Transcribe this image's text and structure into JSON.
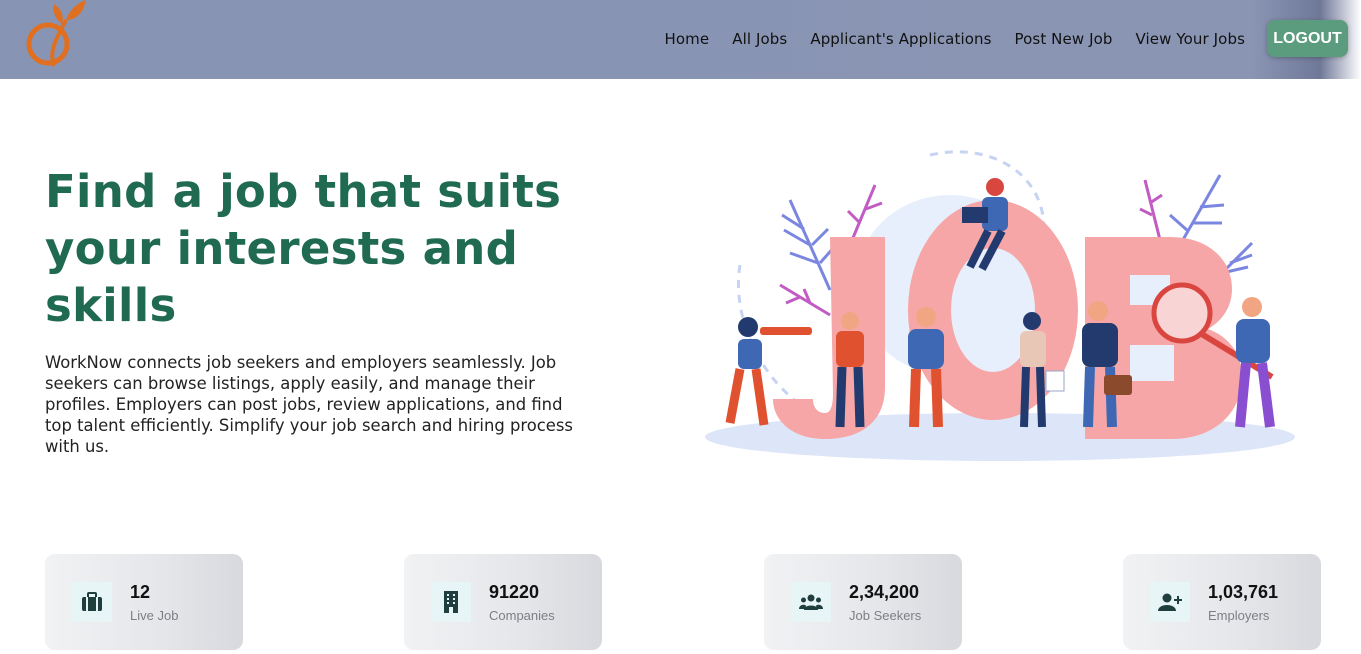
{
  "app": {
    "logo_icon": "leaf-swirl-logo-icon",
    "brand_color": "#e07020"
  },
  "nav": {
    "items": [
      {
        "label": "Home"
      },
      {
        "label": "All Jobs"
      },
      {
        "label": "Applicant's Applications"
      },
      {
        "label": "Post New Job"
      },
      {
        "label": "View Your Jobs"
      }
    ],
    "logout_label": "LOGOUT",
    "logout_color": "#5c9c7e"
  },
  "hero": {
    "title": "Find a job that suits your interests and skills",
    "description": "WorkNow connects job seekers and employers seamlessly. Job seekers can browse listings, apply easily, and manage their profiles. Employers can post jobs, review applications, and find top talent efficiently. Simplify your job search and hiring process with us.",
    "title_color": "#1f6a51",
    "illustration_text": "JOB"
  },
  "stats": [
    {
      "value": "12",
      "label": "Live Job",
      "icon": "briefcase-icon"
    },
    {
      "value": "91220",
      "label": "Companies",
      "icon": "building-icon"
    },
    {
      "value": "2,34,200",
      "label": "Job Seekers",
      "icon": "users-icon"
    },
    {
      "value": "1,03,761",
      "label": "Employers",
      "icon": "user-plus-icon"
    }
  ]
}
